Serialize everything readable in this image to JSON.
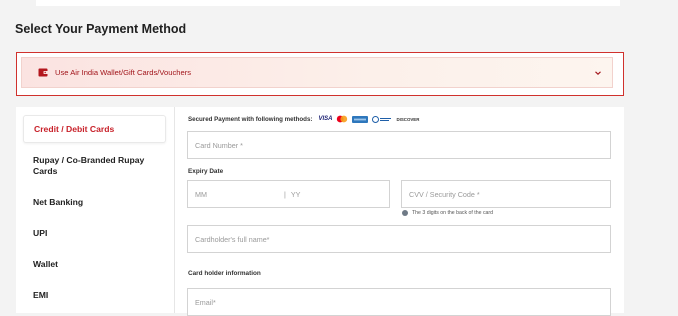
{
  "page": {
    "title": "Select Your Payment Method"
  },
  "wallet": {
    "label": "Use Air India Wallet/Gift Cards/Vouchers",
    "icon": "wallet-icon",
    "chevron": "chevron-down-icon"
  },
  "sidebar": {
    "items": [
      {
        "label": "Credit / Debit Cards",
        "active": true
      },
      {
        "label": "Rupay / Co-Branded Rupay Cards",
        "active": false
      },
      {
        "label": "Net Banking",
        "active": false
      },
      {
        "label": "UPI",
        "active": false
      },
      {
        "label": "Wallet",
        "active": false
      },
      {
        "label": "EMI",
        "active": false
      }
    ]
  },
  "form": {
    "secured_text": "Secured Payment with following methods:",
    "logos": {
      "visa": "VISA",
      "discover": "DISCOVER"
    },
    "card_number_placeholder": "Card Number *",
    "expiry_label": "Expiry Date",
    "mm_placeholder": "MM",
    "yy_placeholder": "YY",
    "cvv_placeholder": "CVV / Security Code *",
    "cvv_hint": "The 3 digits on the back of the card",
    "cardholder_placeholder": "Cardholder's full name*",
    "holder_info_label": "Card holder information",
    "email_placeholder": "Email*"
  },
  "colors": {
    "accent": "#c8212a",
    "border_highlight": "#d0312d"
  }
}
